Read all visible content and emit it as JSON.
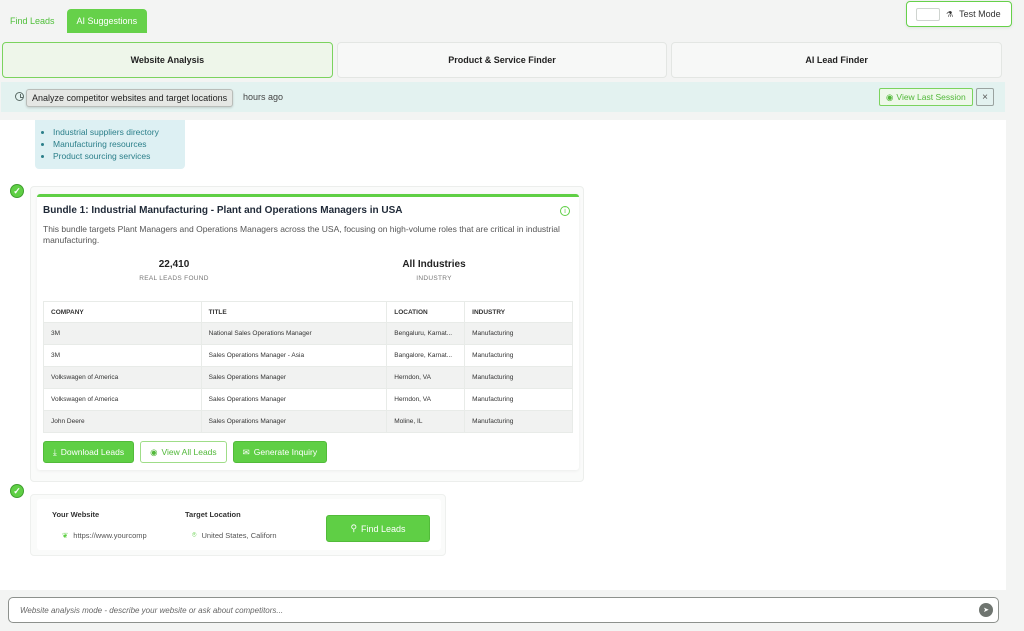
{
  "top_tabs": {
    "find_leads": "Find Leads",
    "ai_suggestions": "AI Suggestions"
  },
  "test_mode": {
    "label": "Test Mode"
  },
  "mode_tabs": [
    {
      "label": "Website Analysis",
      "active": true
    },
    {
      "label": "Product & Service Finder",
      "active": false
    },
    {
      "label": "AI Lead Finder",
      "active": false
    }
  ],
  "status": {
    "tooltip": "Analyze competitor websites and target locations",
    "time_ago": "hours ago",
    "view_last": "View Last Session",
    "close": "×"
  },
  "suggestions": [
    "Industrial suppliers directory",
    "Manufacturing resources",
    "Product sourcing services"
  ],
  "bundle": {
    "title": "Bundle 1: Industrial Manufacturing - Plant and Operations Managers in USA",
    "description": "This bundle targets Plant Managers and Operations Managers across the USA, focusing on high-volume roles that are critical in industrial manufacturing.",
    "stats": [
      {
        "value": "22,410",
        "label": "REAL LEADS FOUND"
      },
      {
        "value": "All Industries",
        "label": "INDUSTRY"
      }
    ],
    "table": {
      "headers": [
        "COMPANY",
        "TITLE",
        "LOCATION",
        "INDUSTRY"
      ],
      "rows": [
        [
          "3M",
          "National Sales Operations Manager",
          "Bengaluru, Karnat...",
          "Manufacturing"
        ],
        [
          "3M",
          "Sales Operations Manager - Asia",
          "Bangalore, Karnat...",
          "Manufacturing"
        ],
        [
          "Volkswagen of America",
          "Sales Operations Manager",
          "Herndon, VA",
          "Manufacturing"
        ],
        [
          "Volkswagen of America",
          "Sales Operations Manager",
          "Herndon, VA",
          "Manufacturing"
        ],
        [
          "John Deere",
          "Sales Operations Manager",
          "Moline, IL",
          "Manufacturing"
        ]
      ]
    },
    "buttons": {
      "download": "Download Leads",
      "view_all": "View All Leads",
      "inquiry": "Generate Inquiry"
    }
  },
  "form": {
    "website_label": "Your Website",
    "website_value": "https://www.yourcomp",
    "location_label": "Target Location",
    "location_value": "United States, Californ",
    "find_button": "Find Leads"
  },
  "chat_input": {
    "placeholder": "Website analysis mode - describe your website or ask about competitors..."
  },
  "colors": {
    "accent": "#5fcf45",
    "strip": "#e3f2f0"
  }
}
